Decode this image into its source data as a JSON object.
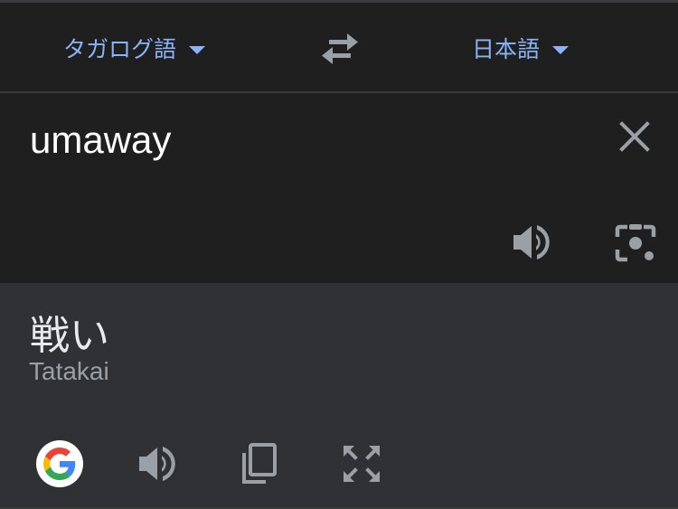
{
  "languages": {
    "source_label": "タガログ語",
    "target_label": "日本語"
  },
  "input": {
    "text": "umaway"
  },
  "output": {
    "translation": "戦い",
    "romanization": "Tatakai"
  },
  "icons": {
    "caret": "chevron-down-icon",
    "swap": "swap-arrows-icon",
    "clear": "close-icon",
    "listen": "speaker-icon",
    "camera": "camera-icon",
    "google": "google-logo-icon",
    "copy": "copy-icon",
    "fullscreen": "fullscreen-icon"
  },
  "colors": {
    "accent": "#8ab4f8",
    "background": "#202124",
    "output_background": "#303134",
    "icon_gray": "#9aa0a6"
  }
}
